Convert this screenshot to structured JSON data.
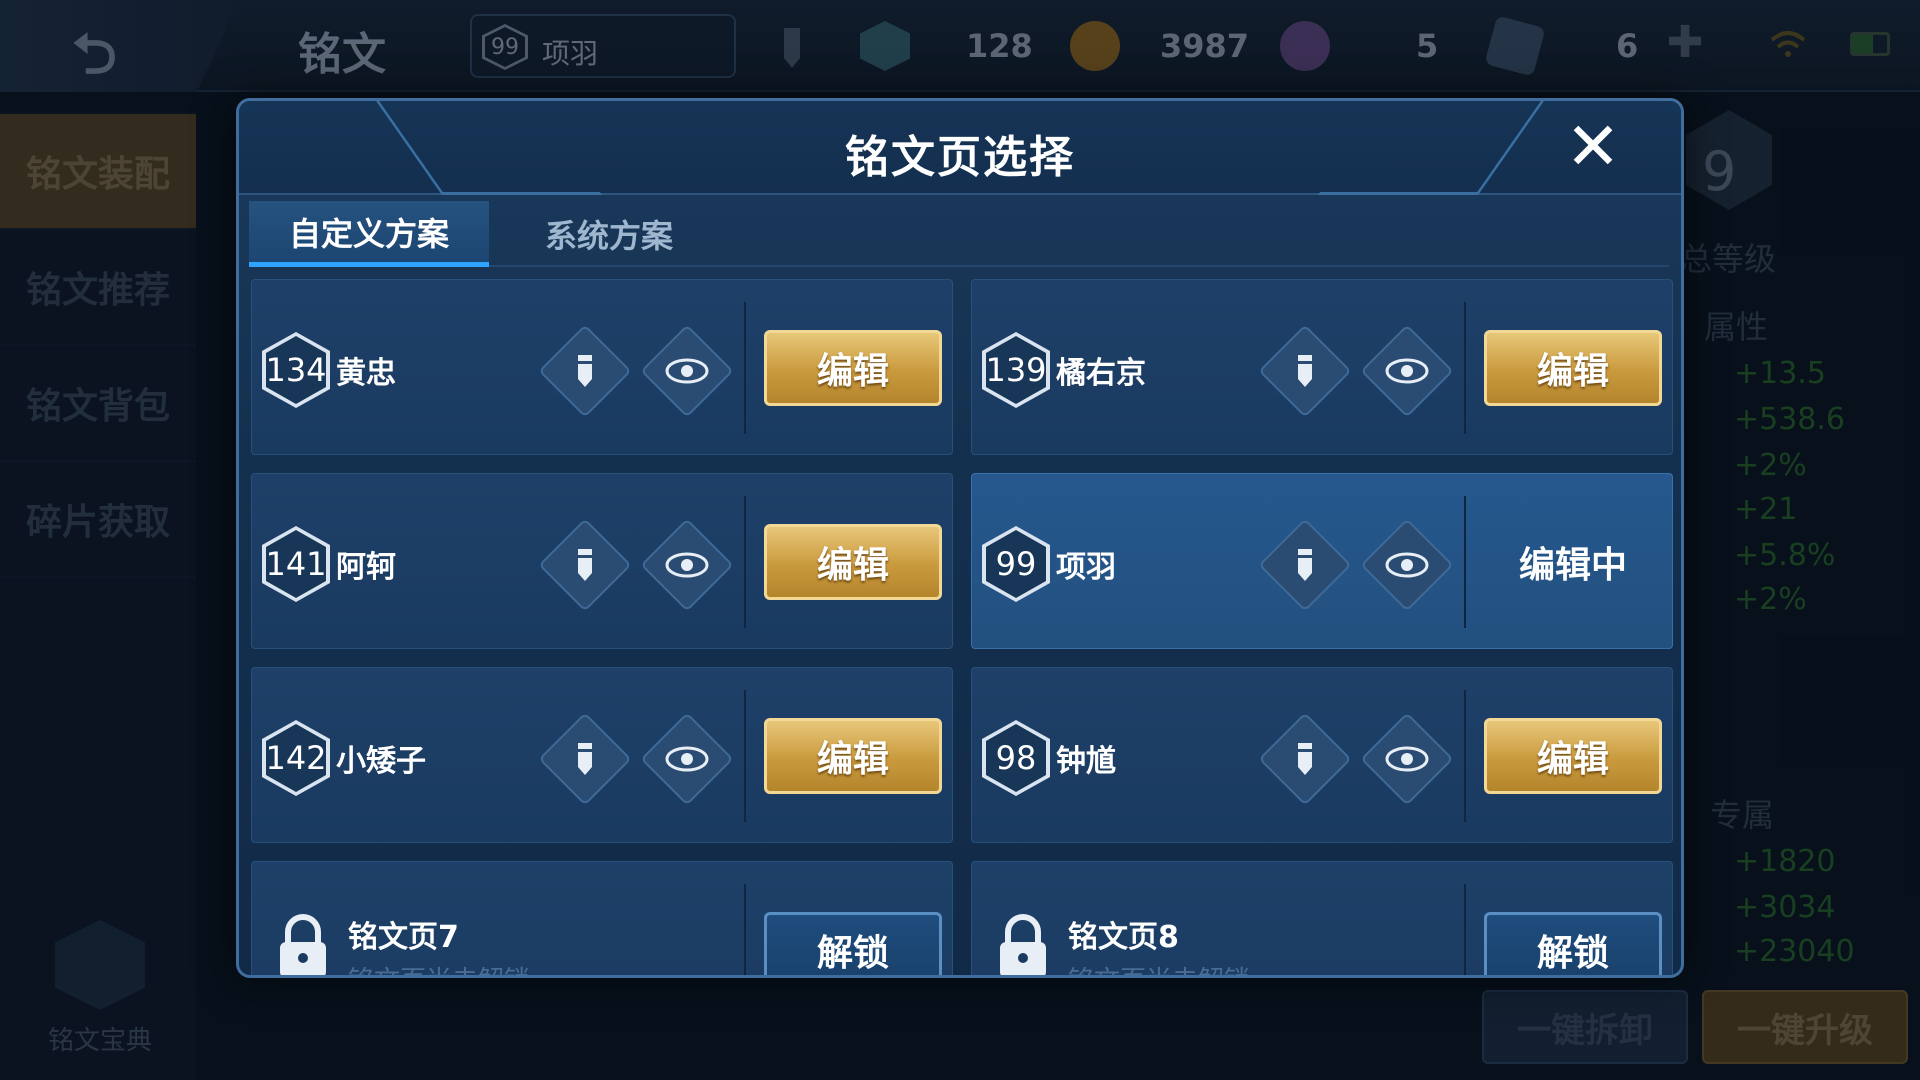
{
  "topbar": {
    "title": "铭文",
    "hero_level": "99",
    "hero_name": "项羽",
    "currencies": [
      {
        "icon": "crystal-icon",
        "value": "128"
      },
      {
        "icon": "gold-coin-icon",
        "value": "3987"
      },
      {
        "icon": "gem-icon",
        "value": "5"
      },
      {
        "icon": "ticket-icon",
        "value": "6"
      }
    ]
  },
  "sidebar": {
    "items": [
      "铭文装配",
      "铭文推荐",
      "铭文背包",
      "碎片获取"
    ],
    "codex_label": "铭文宝典"
  },
  "right_panel": {
    "level_suffix": "9",
    "total_level_label": "总等级",
    "attr_label": "属性",
    "stats": [
      "+13.5",
      "+538.6",
      "+2%",
      "+21",
      "+5.8%",
      "+2%"
    ],
    "exclusive_label": "专属",
    "exclusive_stats": [
      "+1820",
      "+3034",
      "+23040"
    ]
  },
  "bottom_buttons": {
    "disassemble": "一键拆卸",
    "upgrade": "一键升级"
  },
  "modal": {
    "title": "铭文页选择",
    "tabs": [
      "自定义方案",
      "系统方案"
    ],
    "edit_label": "编辑",
    "editing_label": "编辑中",
    "unlock_label": "解锁",
    "pages": [
      {
        "level": "134",
        "name": "黄忠"
      },
      {
        "level": "139",
        "name": "橘右京"
      },
      {
        "level": "141",
        "name": "阿轲"
      },
      {
        "level": "99",
        "name": "项羽"
      },
      {
        "level": "142",
        "name": "小矮子"
      },
      {
        "level": "98",
        "name": "钟馗"
      }
    ],
    "locked": [
      {
        "title": "铭文页7",
        "subtitle": "铭文页尚未解锁"
      },
      {
        "title": "铭文页8",
        "subtitle": "铭文页尚未解锁"
      }
    ]
  },
  "colors": {
    "gold_button": "#c99a3d",
    "active_tab_underline": "#2ea3ff",
    "modal_bg": "#14304f",
    "stat_green": "#2a6a2c"
  }
}
